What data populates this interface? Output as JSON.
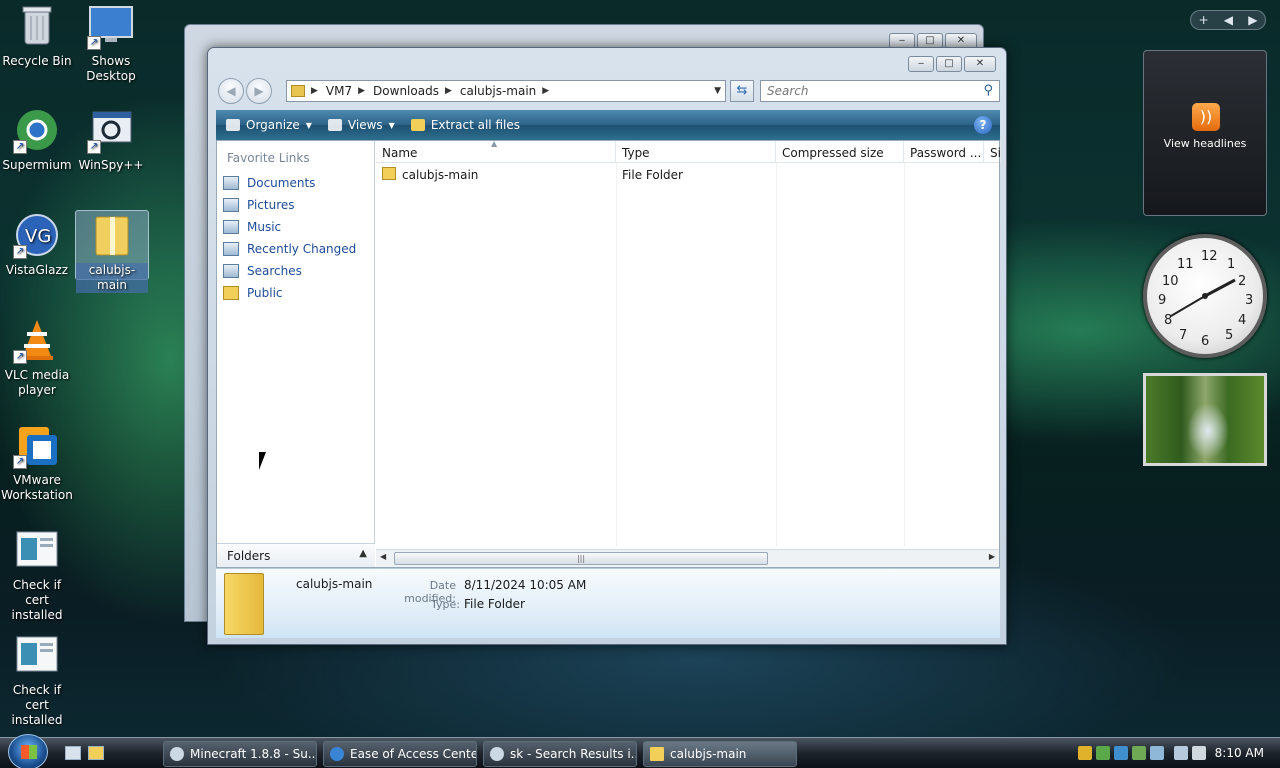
{
  "desktop": {
    "icons": [
      {
        "label": "Recycle Bin"
      },
      {
        "label": "Shows Desktop"
      },
      {
        "label": "Supermium"
      },
      {
        "label": "WinSpy++"
      },
      {
        "label": "VistaGlazz"
      },
      {
        "label": "calubjs-main"
      },
      {
        "label": "VLC media player"
      },
      {
        "label": "VMware Workstation"
      },
      {
        "label": "Check if cert installed"
      },
      {
        "label": "Check if cert installed"
      }
    ]
  },
  "explorer": {
    "address": {
      "crumbs": [
        "VM7",
        "Downloads",
        "calubjs-main"
      ]
    },
    "search_placeholder": "Search",
    "toolbar": {
      "organize": "Organize",
      "views": "Views",
      "extract": "Extract all files",
      "help": "?"
    },
    "nav": {
      "heading": "Favorite Links",
      "links": [
        "Documents",
        "Pictures",
        "Music",
        "Recently Changed",
        "Searches",
        "Public"
      ],
      "folders_label": "Folders"
    },
    "columns": [
      "Name",
      "Type",
      "Compressed size",
      "Password ...",
      "Si"
    ],
    "rows": [
      {
        "name": "calubjs-main",
        "type": "File Folder"
      }
    ],
    "details": {
      "name": "calubjs-main",
      "date_label": "Date modified:",
      "date_value": "8/11/2024 10:05 AM",
      "type_label": "Type:",
      "type_value": "File Folder"
    }
  },
  "gadgets": {
    "rss_label": "View headlines",
    "sidebar_add": "+",
    "clock_numbers": [
      "12",
      "1",
      "2",
      "3",
      "4",
      "5",
      "6",
      "7",
      "8",
      "9",
      "10",
      "11"
    ]
  },
  "taskbar": {
    "buttons": [
      "Minecraft 1.8.8 - Su...",
      "Ease of Access Center",
      "sk - Search Results i...",
      "calubjs-main"
    ],
    "time": "8:10 AM"
  }
}
